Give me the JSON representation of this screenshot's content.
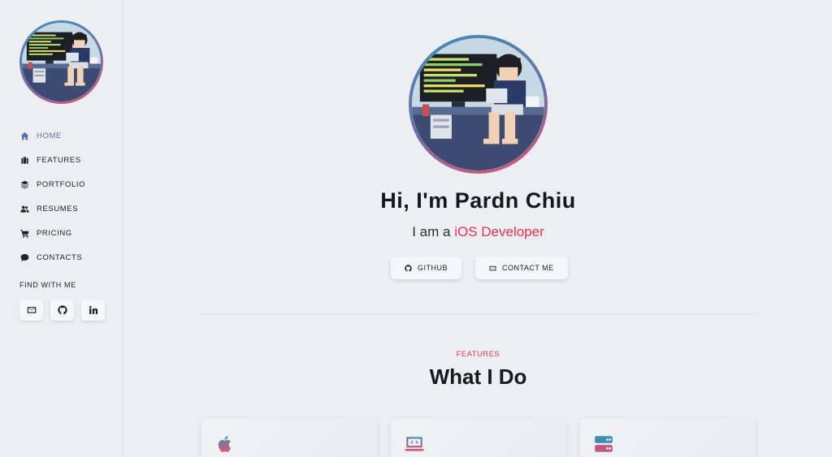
{
  "nav": {
    "items": [
      {
        "label": "HOME",
        "icon": "home-icon",
        "active": true
      },
      {
        "label": "FEATURES",
        "icon": "briefcase-icon"
      },
      {
        "label": "PORTFOLIO",
        "icon": "layers-icon"
      },
      {
        "label": "RESUMES",
        "icon": "users-icon"
      },
      {
        "label": "PRICING",
        "icon": "cart-icon"
      },
      {
        "label": "CONTACTS",
        "icon": "chat-icon"
      }
    ],
    "find_title": "FIND WITH ME",
    "socials": [
      "mail-icon",
      "github-icon",
      "linkedin-icon"
    ]
  },
  "hero": {
    "title": "Hi, I'm Pardn Chiu",
    "subtitle_prefix": "I am a ",
    "subtitle_role": "iOS Developer",
    "buttons": {
      "github": "GITHUB",
      "contact": "CONTACT ME"
    }
  },
  "features": {
    "tag": "FEATURES",
    "title": "What I Do",
    "cards": [
      "apple-icon",
      "laptop-code-icon",
      "server-icon"
    ]
  },
  "colors": {
    "accent": "#e8334e",
    "active_nav": "#5a70b0",
    "avatar_ring_start": "#3f8eb8",
    "avatar_ring_end": "#e0556f"
  }
}
